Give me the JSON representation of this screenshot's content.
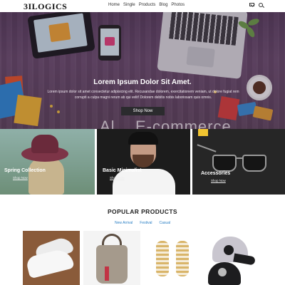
{
  "header": {
    "logo": "3ILOGICS",
    "nav": [
      "Home",
      "Single",
      "Products",
      "Blog",
      "Photos"
    ],
    "icons": [
      "mail-icon",
      "search-icon"
    ]
  },
  "hero": {
    "title": "Lorem Ipsum Dolor Sit Amet.",
    "text": "Lorem ipsum dolor sit amet consectetur adipisicing elit. Recusandae dolorem, exercitationem veniam, ut dolore fugiat rem corrupti a culpa magni rerum ab qui velit! Dolorem debitis nobis laboriosam quis omnis.",
    "button": "Shop Now",
    "watermark": "Al... E-commerce"
  },
  "categories": [
    {
      "title": "Spring Collection",
      "link": "Shop Now"
    },
    {
      "title": "Basic Minimalist",
      "link": "Shop Now"
    },
    {
      "title": "Accessories",
      "link": "Shop Now"
    }
  ],
  "popular": {
    "title": "POPULAR PRODUCTS",
    "filters": [
      "New Arrival",
      "Festival",
      "Casual"
    ]
  },
  "colors": {
    "hero_bg": "#5e4462",
    "button_bg": "#2b2b2e",
    "filter_link": "#2a7fc4"
  }
}
